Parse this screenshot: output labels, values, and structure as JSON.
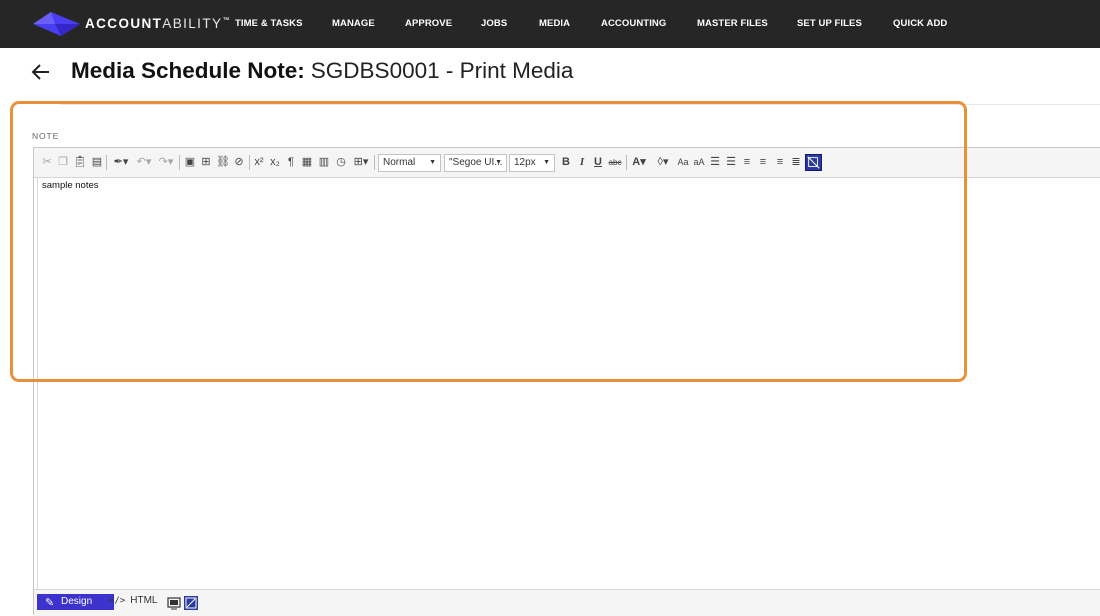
{
  "app": {
    "brand_bold": "ACCOUNT",
    "brand_light": "ABILITY",
    "brand_tm": "™",
    "logo_icon": "accountability-logo-icon",
    "accent_color": "#3b33cc"
  },
  "nav": {
    "items": [
      {
        "label": "TIME & TASKS"
      },
      {
        "label": "MANAGE"
      },
      {
        "label": "APPROVE"
      },
      {
        "label": "JOBS"
      },
      {
        "label": "MEDIA"
      },
      {
        "label": "ACCOUNTING"
      },
      {
        "label": "MASTER FILES"
      },
      {
        "label": "SET UP FILES"
      },
      {
        "label": "QUICK ADD"
      }
    ]
  },
  "header": {
    "back_icon": "arrow-left-icon",
    "title_bold": "Media Schedule Note:",
    "title_value": "SGDBS0001 - Print Media"
  },
  "form": {
    "note_label": "NOTE"
  },
  "editor": {
    "content": "sample notes",
    "toolbar": {
      "format_value": "Normal",
      "font_value": "\"Segoe UI...",
      "size_value": "12px",
      "bold_label": "B",
      "italic_label": "I",
      "underline_label": "U",
      "strike_label": "abc",
      "font_color_label": "A",
      "case_label_1": "Aa",
      "case_label_2": "aA",
      "superscript_label": "x²",
      "subscript_label": "x₂"
    },
    "modes": {
      "design_label": "Design",
      "html_label": "HTML",
      "html_code_glyph": "</>"
    }
  },
  "highlight_color": "#e8913a"
}
